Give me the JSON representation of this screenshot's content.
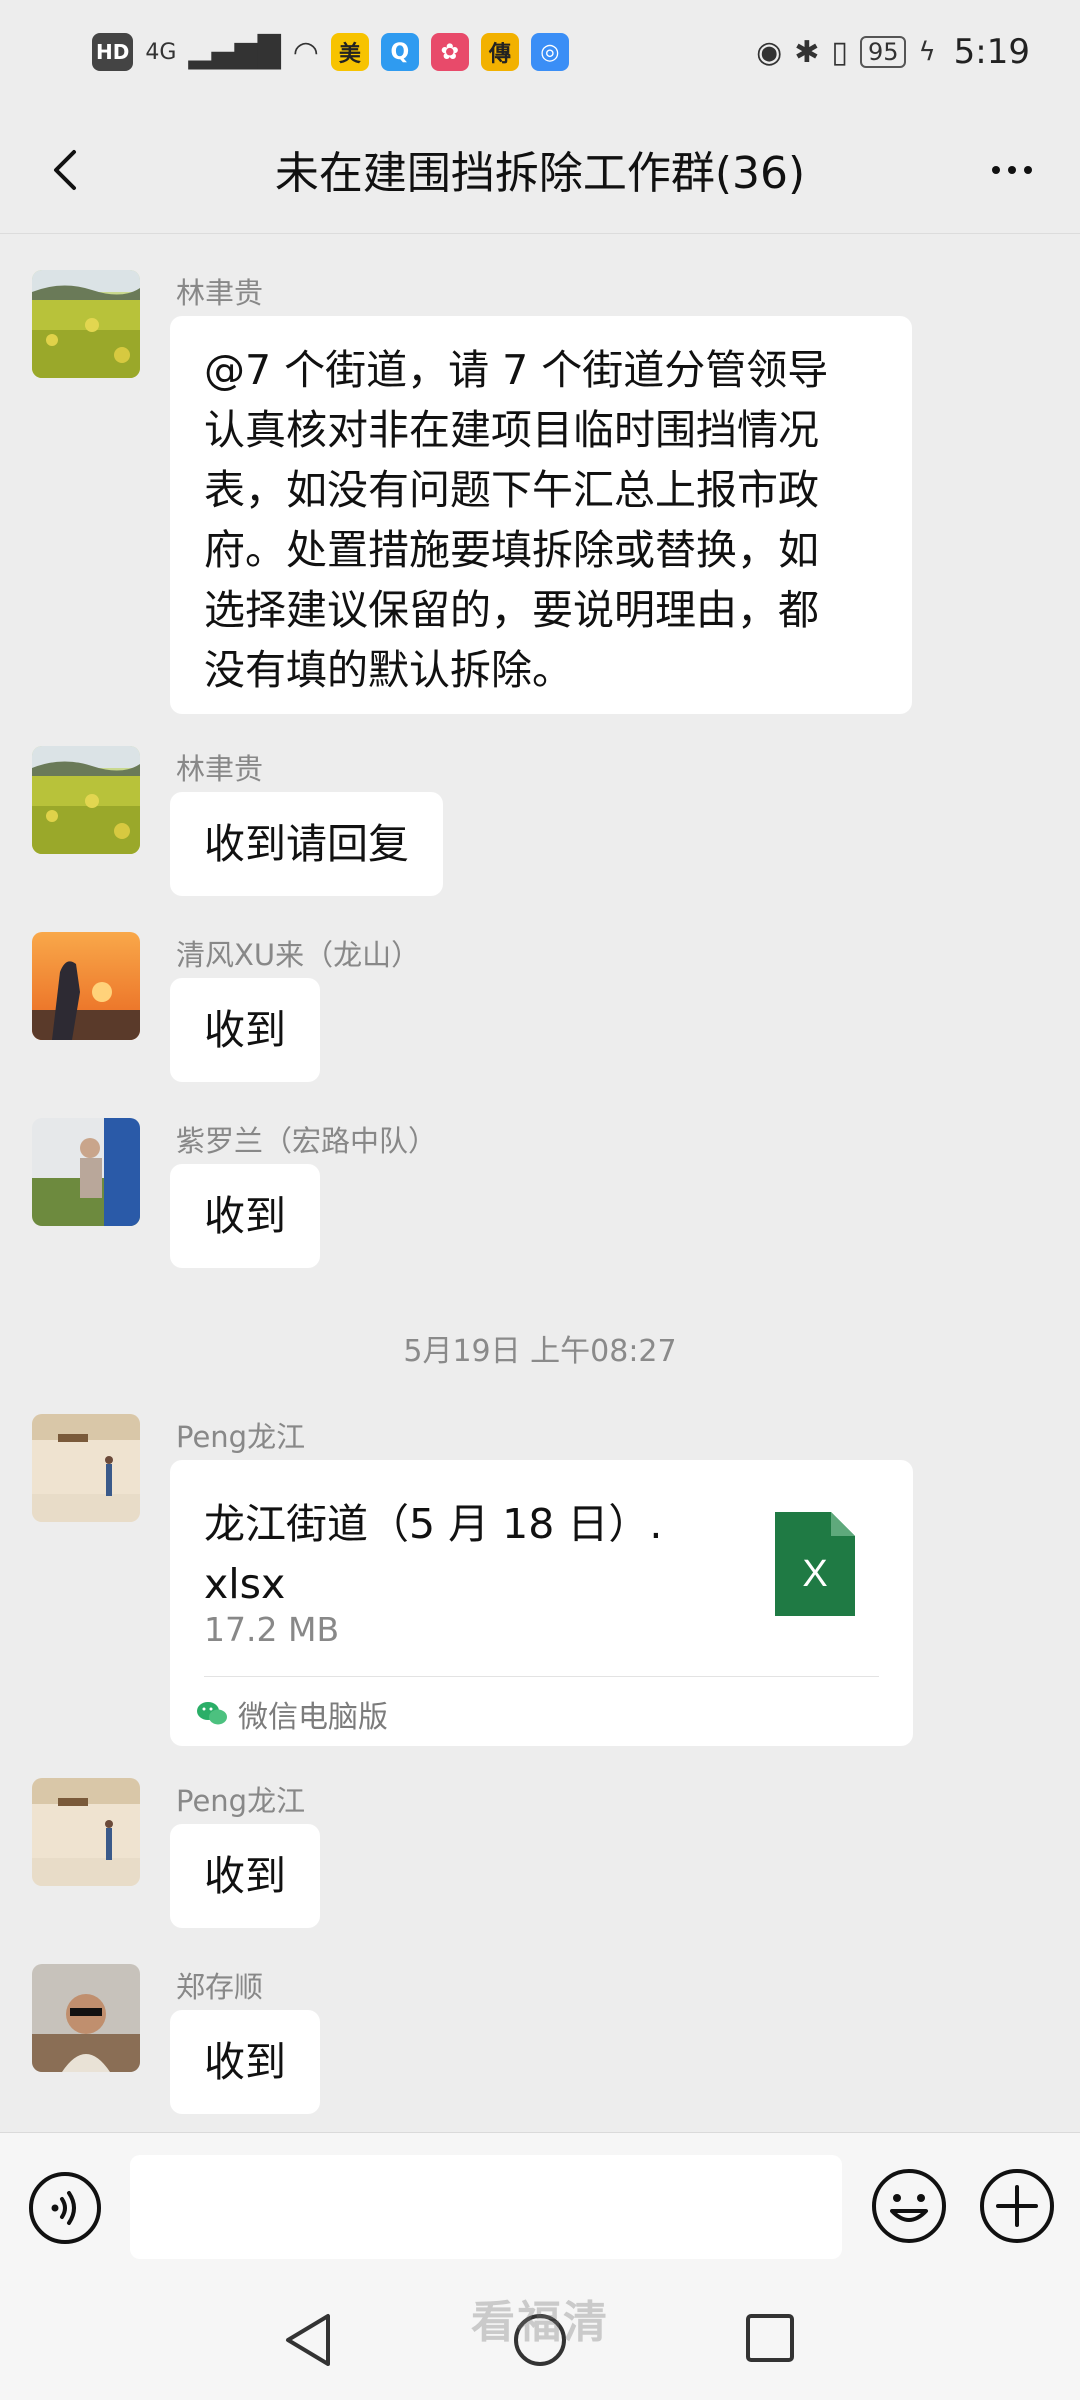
{
  "status_bar": {
    "network_type": "4G",
    "hd_label": "HD",
    "app_chips": [
      {
        "label": "美",
        "color": "#f7c300",
        "text_color": "#222"
      },
      {
        "label": "Q",
        "color": "#2f9bf0",
        "text_color": "#fff"
      },
      {
        "label": "✿",
        "color": "#e84a6a",
        "text_color": "#fff"
      },
      {
        "label": "傳",
        "color": "#f2b100",
        "text_color": "#222"
      },
      {
        "label": "◎",
        "color": "#3a8ef6",
        "text_color": "#fff"
      }
    ],
    "battery": "95",
    "time": "5:19"
  },
  "header": {
    "title": "未在建围挡拆除工作群(36)"
  },
  "messages": [
    {
      "sender": "林聿贵",
      "avatar": "rapeseed-field",
      "text_lines": [
        "@7 个街道，请 7 个街道分管领导",
        "认真核对非在建项目临时围挡情况",
        "表，如没有问题下午汇总上报市政",
        "府。处置措施要填拆除或替换，如",
        "选择建议保留的，要说明理由，都",
        "没有填的默认拆除。"
      ]
    },
    {
      "sender": "林聿贵",
      "avatar": "rapeseed-field",
      "text": "收到请回复"
    },
    {
      "sender": "清风XU来（龙山）",
      "avatar": "sunset",
      "text": "收到"
    },
    {
      "sender": "紫罗兰（宏路中队）",
      "avatar": "outdoor",
      "text": "收到"
    }
  ],
  "time_separator": "5月19日 上午08:27",
  "file_message": {
    "sender": "Peng龙江",
    "file_name_lines": [
      "龙江街道（5 月 18 日）.",
      "xlsx"
    ],
    "file_size": "17.2 MB",
    "file_type_label": "X",
    "source": "微信电脑版"
  },
  "later_messages": [
    {
      "sender": "Peng龙江",
      "avatar": "room",
      "text": "收到"
    },
    {
      "sender": "郑存顺",
      "avatar": "man-in-car",
      "text": "收到"
    }
  ],
  "input": {
    "placeholder": ""
  },
  "watermark": "看福清",
  "colors": {
    "background": "#ededed",
    "bubble": "#ffffff",
    "excel_green": "#1f7a44",
    "wechat_green": "#2aae67"
  }
}
